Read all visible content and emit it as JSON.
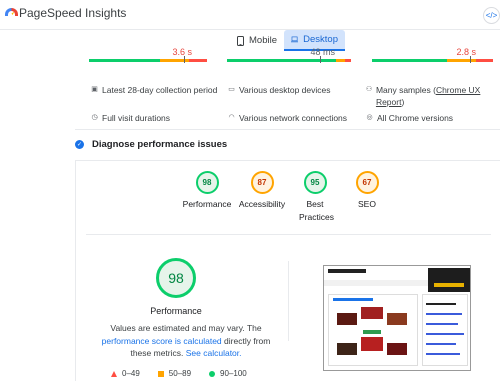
{
  "app": {
    "title": "PageSpeed Insights",
    "share_icon": "share-icon"
  },
  "tabs": [
    {
      "label": "Mobile",
      "icon": "smartphone-icon",
      "selected": false
    },
    {
      "label": "Desktop",
      "icon": "laptop-icon",
      "selected": true
    }
  ],
  "metrics": {
    "values": [
      "3.6 s",
      "48 ms",
      "2.8 s"
    ]
  },
  "info": {
    "collection_period": "Latest 28-day collection period",
    "devices": "Various desktop devices",
    "samples_prefix": "Many samples (",
    "samples_link": "Chrome UX Report",
    "samples_suffix": ")",
    "durations": "Full visit durations",
    "network": "Various network connections",
    "chrome": "All Chrome versions"
  },
  "diagnose": {
    "label": "Diagnose performance issues"
  },
  "scores": [
    {
      "value": "98",
      "label": "Performance",
      "status": "good"
    },
    {
      "value": "87",
      "label": "Accessibility",
      "status": "average"
    },
    {
      "value": "95",
      "label": "Best Practices",
      "status": "good"
    },
    {
      "value": "67",
      "label": "SEO",
      "status": "average"
    }
  ],
  "performance": {
    "score": "98",
    "title": "Performance",
    "note_part1": "Values are estimated and may vary. The",
    "note_link1": "performance score is calculated",
    "note_part2": "directly from these metrics.",
    "note_link2": "See calculator.",
    "legend": [
      {
        "range": "0–49",
        "shape": "triangle"
      },
      {
        "range": "50–89",
        "shape": "square"
      },
      {
        "range": "90–100",
        "shape": "circle"
      }
    ]
  },
  "colors": {
    "good": "#0cce6b",
    "average": "#ffa400",
    "poor": "#ff4e42",
    "accent": "#1a73e8"
  }
}
